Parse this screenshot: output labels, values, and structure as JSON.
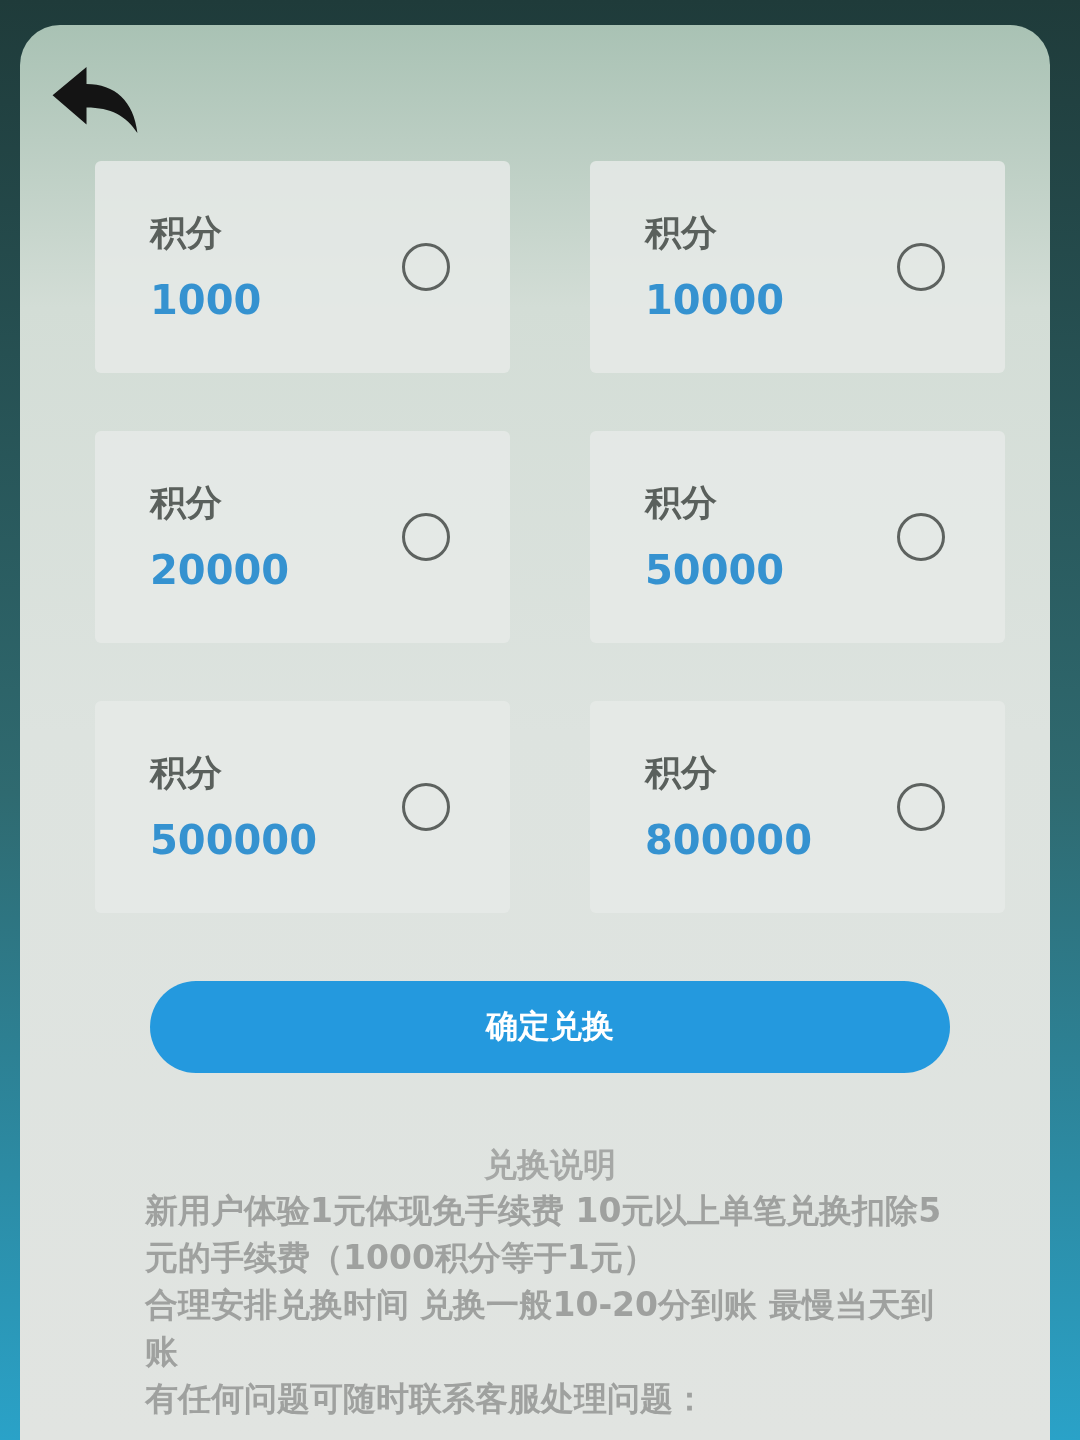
{
  "options": [
    {
      "label": "积分",
      "value": "1000",
      "selected": false
    },
    {
      "label": "积分",
      "value": "10000",
      "selected": false
    },
    {
      "label": "积分",
      "value": "20000",
      "selected": false
    },
    {
      "label": "积分",
      "value": "50000",
      "selected": false
    },
    {
      "label": "积分",
      "value": "500000",
      "selected": false
    },
    {
      "label": "积分",
      "value": "800000",
      "selected": false
    }
  ],
  "confirm_button": "确定兑换",
  "notes": {
    "title": "兑换说明",
    "paragraphs": [
      "新用户体验1元体现免手续费 10元以上单笔兑换扣除5元的手续费（1000积分等于1元）",
      "合理安排兑换时间 兑换一般10-20分到账 最慢当天到账",
      "有任何问题可随时联系客服处理问题："
    ]
  }
}
